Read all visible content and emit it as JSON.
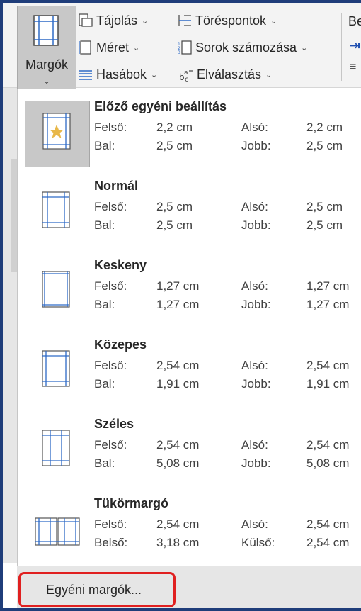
{
  "ribbon": {
    "margins_button": {
      "label": "Margók",
      "icon": "margins-icon"
    },
    "orientation": {
      "label": "Tájolás",
      "icon": "orientation-icon"
    },
    "size": {
      "label": "Méret",
      "icon": "size-icon"
    },
    "columns": {
      "label": "Hasábok",
      "icon": "columns-icon"
    },
    "breaks": {
      "label": "Töréspontok",
      "icon": "breaks-icon"
    },
    "line_numbers": {
      "label": "Sorok számozása",
      "icon": "line-numbers-icon"
    },
    "hyphenation": {
      "label": "Elválasztás",
      "icon": "hyphenation-icon"
    },
    "next_group_label": "Be"
  },
  "gallery": {
    "entries": [
      {
        "title": "Előző egyéni beállítás",
        "icon": "last-custom-setting-icon",
        "selected": true,
        "row1": {
          "label_a": "Felső:",
          "value_a": "2,2 cm",
          "label_b": "Alsó:",
          "value_b": "2,2 cm"
        },
        "row2": {
          "label_a": "Bal:",
          "value_a": "2,5 cm",
          "label_b": "Jobb:",
          "value_b": "2,5 cm"
        }
      },
      {
        "title": "Normál",
        "icon": "normal-margins-icon",
        "selected": false,
        "row1": {
          "label_a": "Felső:",
          "value_a": "2,5 cm",
          "label_b": "Alsó:",
          "value_b": "2,5 cm"
        },
        "row2": {
          "label_a": "Bal:",
          "value_a": "2,5 cm",
          "label_b": "Jobb:",
          "value_b": "2,5 cm"
        }
      },
      {
        "title": "Keskeny",
        "icon": "narrow-margins-icon",
        "selected": false,
        "row1": {
          "label_a": "Felső:",
          "value_a": "1,27 cm",
          "label_b": "Alsó:",
          "value_b": "1,27 cm"
        },
        "row2": {
          "label_a": "Bal:",
          "value_a": "1,27 cm",
          "label_b": "Jobb:",
          "value_b": "1,27 cm"
        }
      },
      {
        "title": "Közepes",
        "icon": "moderate-margins-icon",
        "selected": false,
        "row1": {
          "label_a": "Felső:",
          "value_a": "2,54 cm",
          "label_b": "Alsó:",
          "value_b": "2,54 cm"
        },
        "row2": {
          "label_a": "Bal:",
          "value_a": "1,91 cm",
          "label_b": "Jobb:",
          "value_b": "1,91 cm"
        }
      },
      {
        "title": "Széles",
        "icon": "wide-margins-icon",
        "selected": false,
        "row1": {
          "label_a": "Felső:",
          "value_a": "2,54 cm",
          "label_b": "Alsó:",
          "value_b": "2,54 cm"
        },
        "row2": {
          "label_a": "Bal:",
          "value_a": "5,08 cm",
          "label_b": "Jobb:",
          "value_b": "5,08 cm"
        }
      },
      {
        "title": "Tükörmargó",
        "icon": "mirrored-margins-icon",
        "selected": false,
        "row1": {
          "label_a": "Felső:",
          "value_a": "2,54 cm",
          "label_b": "Alsó:",
          "value_b": "2,54 cm"
        },
        "row2": {
          "label_a": "Belső:",
          "value_a": "3,18 cm",
          "label_b": "Külső:",
          "value_b": "2,54 cm"
        }
      }
    ]
  },
  "footer": {
    "custom_margins_label": "Egyéni margók...",
    "highlight_color": "#e02020"
  },
  "colors": {
    "accent": "#1f4fb0",
    "frame": "#1f3d7a",
    "selected_bg": "#c8c8c8",
    "star": "#e8b84a"
  }
}
